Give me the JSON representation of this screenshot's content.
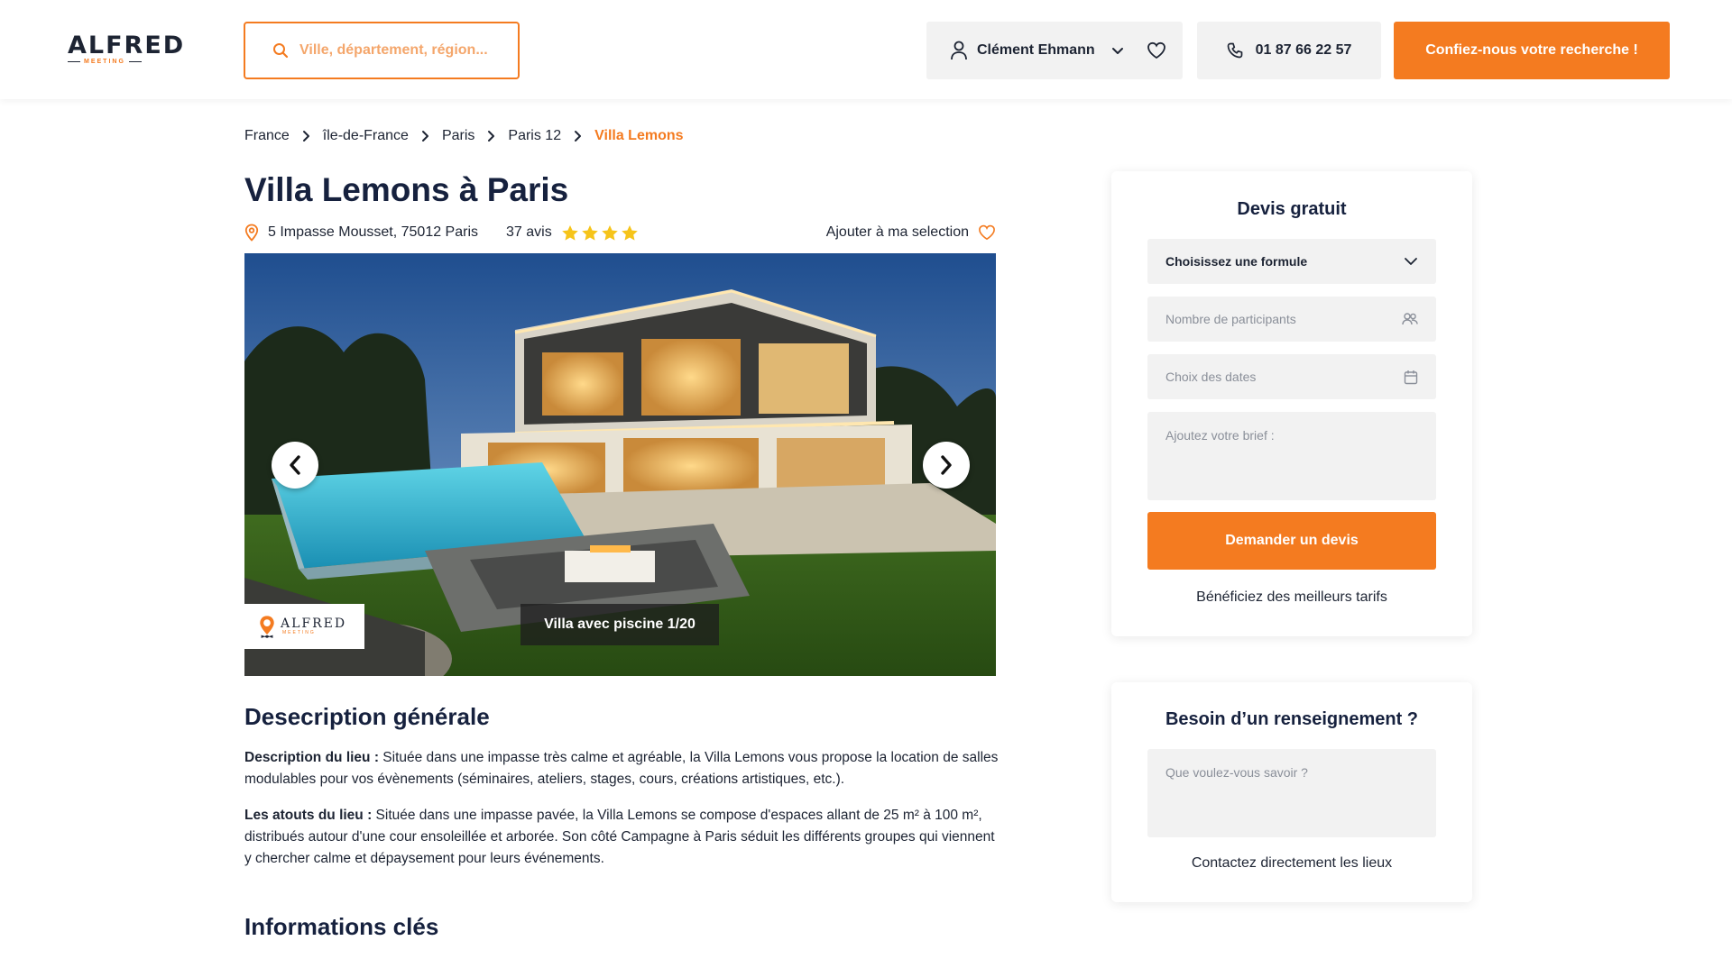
{
  "header": {
    "logo_word": "ALFRED",
    "logo_sub": "MEETING",
    "search_placeholder": "Ville, département, région...",
    "user_name": "Clément Ehmann",
    "phone": "01 87 66 22 57",
    "cta_label": "Confiez-nous votre recherche !"
  },
  "breadcrumb": {
    "items": [
      "France",
      "île-de-France",
      "Paris",
      "Paris 12",
      "Villa Lemons"
    ]
  },
  "venue": {
    "title": "Villa Lemons à Paris",
    "address": "5 Impasse Mousset, 75012 Paris",
    "reviews": "37 avis",
    "rating": 4,
    "add_selection": "Ajouter à ma selection"
  },
  "gallery": {
    "caption": "Villa avec piscine 1/20",
    "logo_word": "ALFRED",
    "logo_sub": "MEETING"
  },
  "description": {
    "heading": "Desecription générale",
    "p1_label": "Description du lieu :",
    "p1_text": " Située dans une impasse très calme et agréable, la Villa Lemons vous propose la location de salles modulables pour vos évènements (séminaires, ateliers, stages, cours, créations artistiques, etc.).",
    "p2_label": "Les atouts du lieu :",
    "p2_text": " Située dans une impasse pavée, la Villa Lemons se compose d'espaces allant de 25 m² à 100 m², distribués autour d'une cour ensoleillée et arborée. Son côté Campagne à Paris séduit les différents groupes qui viennent y chercher calme et dépaysement pour leurs événements."
  },
  "key_info": {
    "heading": "Informations clés"
  },
  "quote_card": {
    "title": "Devis gratuit",
    "formula_placeholder": "Choisissez une formule",
    "participants_placeholder": "Nombre de participants",
    "dates_placeholder": "Choix des dates",
    "brief_placeholder": "Ajoutez votre brief :",
    "submit_label": "Demander un devis",
    "footer": "Bénéficiez des meilleurs tarifs"
  },
  "info_card": {
    "title": "Besoin d’un renseignement ?",
    "question_placeholder": "Que voulez-vous savoir ?",
    "footer": "Contactez directement les lieux"
  },
  "colors": {
    "accent": "#f47b20",
    "text": "#1d2433",
    "field_bg": "#f2f2f2"
  },
  "icons": [
    "location-pin-icon",
    "search-icon",
    "user-icon",
    "chevron-down-icon",
    "heart-icon",
    "phone-icon",
    "chevron-right-icon",
    "star-icon",
    "arrow-left-icon",
    "arrow-right-icon",
    "participants-icon",
    "calendar-icon"
  ]
}
